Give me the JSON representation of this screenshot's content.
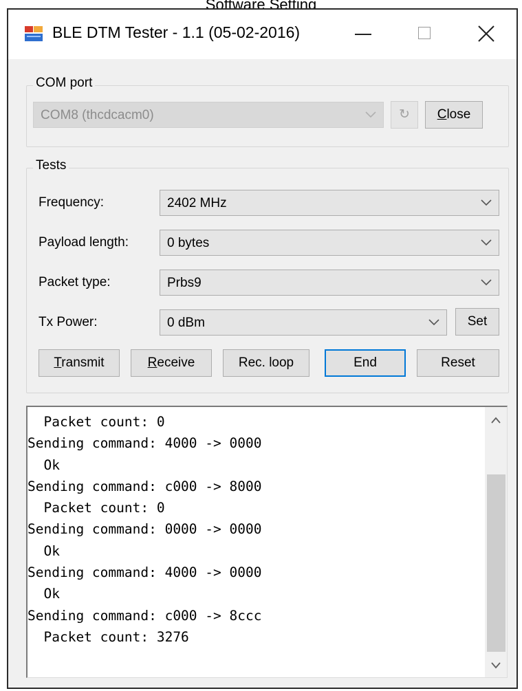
{
  "caption": "Software Setting",
  "window": {
    "title": "BLE DTM Tester - 1.1 (05-02-2016)",
    "icons": {
      "app": "app-icon",
      "minimize": "minimize-icon",
      "maximize": "maximize-icon",
      "close": "close-icon"
    }
  },
  "com_port": {
    "group_label": "COM port",
    "selected": "COM8 (thcdcacm0)",
    "refresh_label": "↻",
    "close_label_first": "C",
    "close_label_rest": "lose"
  },
  "tests": {
    "group_label": "Tests",
    "frequency": {
      "label": "Frequency:",
      "value": "2402 MHz"
    },
    "payload_length": {
      "label": "Payload length:",
      "value": "0 bytes"
    },
    "packet_type": {
      "label": "Packet type:",
      "value": "Prbs9"
    },
    "tx_power": {
      "label": "Tx Power:",
      "value": "0 dBm",
      "set_label": "Set"
    },
    "buttons": {
      "transmit_first": "T",
      "transmit_rest": "ransmit",
      "receive_first": "R",
      "receive_rest": "eceive",
      "rec_loop": "Rec. loop",
      "end": "End",
      "reset": "Reset"
    }
  },
  "log": {
    "lines": [
      "  Packet count: 0",
      "Sending command: 4000 -> 0000",
      "  Ok",
      "Sending command: c000 -> 8000",
      "  Packet count: 0",
      "Sending command: 0000 -> 0000",
      "  Ok",
      "Sending command: 4000 -> 0000",
      "  Ok",
      "Sending command: c000 -> 8ccc",
      "  Packet count: 3276"
    ]
  }
}
